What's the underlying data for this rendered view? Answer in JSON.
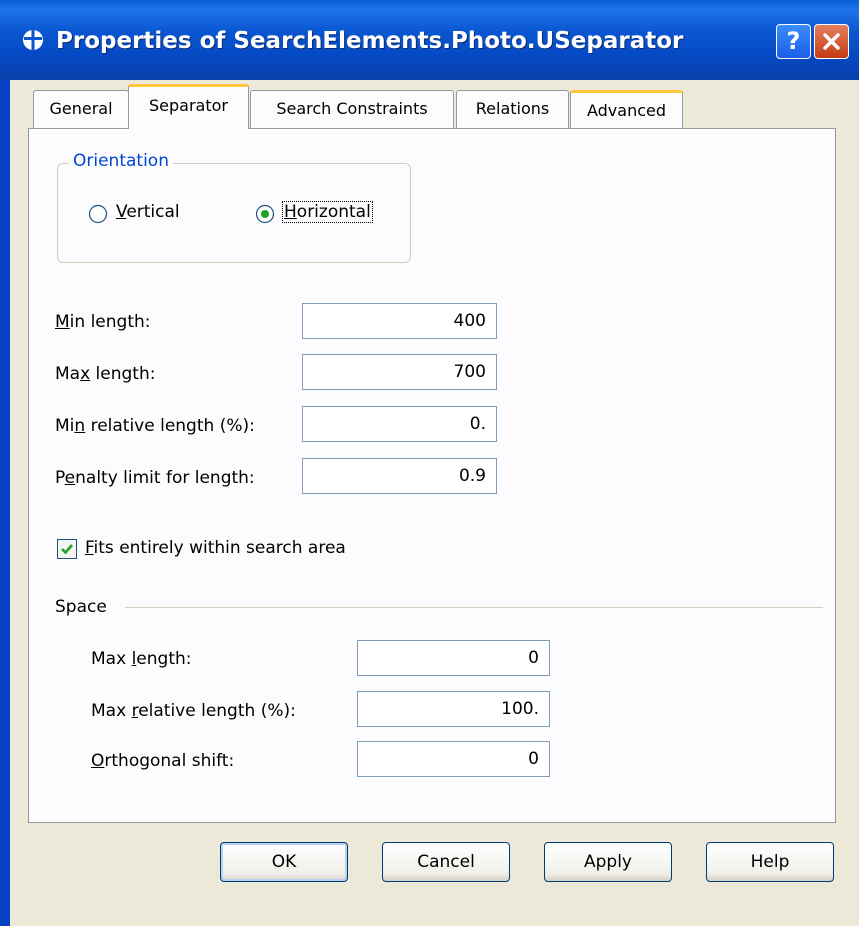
{
  "window": {
    "title": "Properties of SearchElements.Photo.USeparator",
    "help_glyph": "?",
    "icons": {
      "logo": "app-logo-icon",
      "help": "help-icon",
      "close": "close-icon"
    },
    "colors": {
      "titlebar": "#0a56d0",
      "face": "#ece9d8",
      "accent_tab": "#ffc83c",
      "group_title": "#0046d5"
    }
  },
  "tabs": [
    {
      "label": "General",
      "active": false
    },
    {
      "label": "Separator",
      "active": true
    },
    {
      "label": "Search Constraints",
      "active": false
    },
    {
      "label": "Relations",
      "active": false
    },
    {
      "label": "Advanced",
      "active": false
    }
  ],
  "orientation": {
    "title": "Orientation",
    "options": [
      {
        "mnemonic": "V",
        "rest": "ertical",
        "selected": false
      },
      {
        "mnemonic": "H",
        "rest": "orizontal",
        "selected": true
      }
    ]
  },
  "fields": [
    {
      "pre": "",
      "mnemonic": "M",
      "post": "in length:",
      "value": "400"
    },
    {
      "pre": "Ma",
      "mnemonic": "x",
      "post": " length:",
      "value": "700"
    },
    {
      "pre": "Mi",
      "mnemonic": "n",
      "post": " relative length (%):",
      "value": "0."
    },
    {
      "pre": "P",
      "mnemonic": "e",
      "post": "nalty limit for length:",
      "value": "0.9"
    }
  ],
  "fits_checkbox": {
    "mnemonic": "F",
    "rest": "its entirely within search area",
    "checked": true
  },
  "space": {
    "title": "Space",
    "fields": [
      {
        "pre": "Max ",
        "mnemonic": "l",
        "post": "ength:",
        "value": "0"
      },
      {
        "pre": "Max ",
        "mnemonic": "r",
        "post": "elative length (%):",
        "value": "100."
      },
      {
        "pre": "",
        "mnemonic": "O",
        "post": "rthogonal shift:",
        "value": "0"
      }
    ]
  },
  "buttons": {
    "ok": "OK",
    "cancel": "Cancel",
    "apply": "Apply",
    "help": "Help"
  }
}
